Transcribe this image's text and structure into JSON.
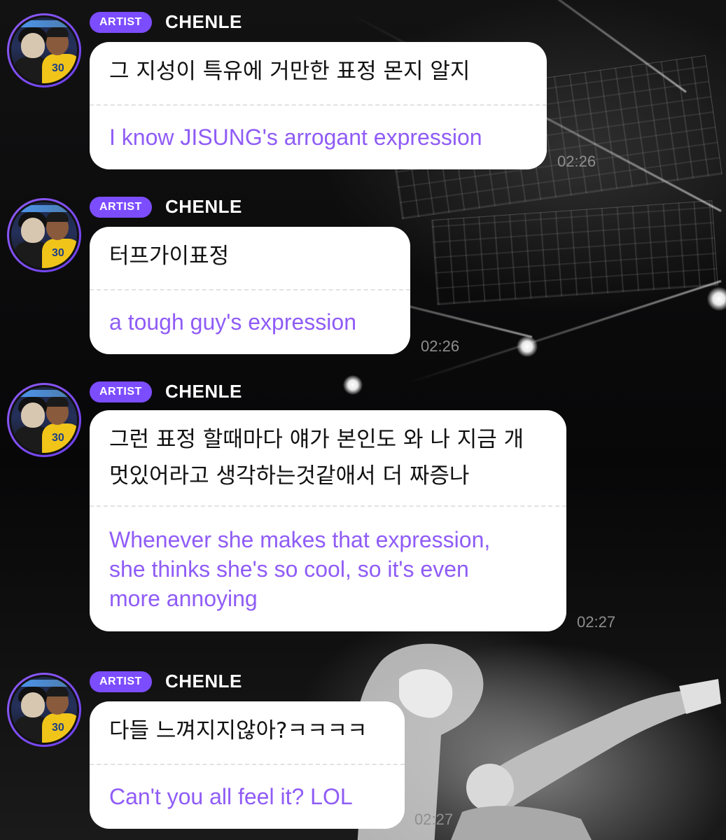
{
  "messages": [
    {
      "badge": "ARTIST",
      "author": "CHENLE",
      "korean_lines": [
        "그 지성이 특유에 거만한 표정 몬지 알지"
      ],
      "english_lines": [
        "I know JISUNG's arrogant expression"
      ],
      "time": "02:26"
    },
    {
      "badge": "ARTIST",
      "author": "CHENLE",
      "korean_lines": [
        "터프가이표정"
      ],
      "english_lines": [
        "a tough guy's expression"
      ],
      "time": "02:26"
    },
    {
      "badge": "ARTIST",
      "author": "CHENLE",
      "korean_lines": [
        "그런 표정 할때마다 얘가 본인도 와 나 지금 개",
        "멋있어라고 생각하는것같애서 더 짜증나"
      ],
      "english_lines": [
        "Whenever she makes that expression,",
        "she thinks she's so cool, so it's even",
        "more annoying"
      ],
      "time": "02:27"
    },
    {
      "badge": "ARTIST",
      "author": "CHENLE",
      "korean_lines": [
        "다들 느껴지지않아?ㅋㅋㅋㅋ"
      ],
      "english_lines": [
        "Can't you all feel it? LOL"
      ],
      "time": "02:27"
    }
  ],
  "avatar_jersey_number": "30",
  "colors": {
    "accent": "#7c4dff",
    "translation_text": "#8f5cf6",
    "bubble": "#ffffff",
    "timestamp": "#8e8e8e"
  }
}
